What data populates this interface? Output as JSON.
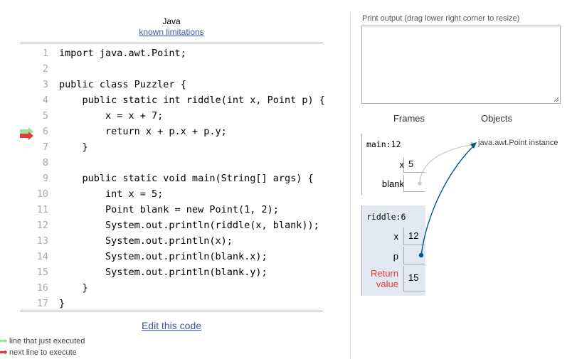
{
  "header": {
    "language": "Java",
    "limitations_link": "known limitations"
  },
  "code": [
    {
      "num": "1",
      "text": "import java.awt.Point;"
    },
    {
      "num": "2",
      "text": ""
    },
    {
      "num": "3",
      "text": "public class Puzzler {"
    },
    {
      "num": "4",
      "text": "    public static int riddle(int x, Point p) {"
    },
    {
      "num": "5",
      "text": "        x = x + 7;"
    },
    {
      "num": "6",
      "text": "        return x + p.x + p.y;"
    },
    {
      "num": "7",
      "text": "    }"
    },
    {
      "num": "8",
      "text": ""
    },
    {
      "num": "9",
      "text": "    public static void main(String[] args) {"
    },
    {
      "num": "10",
      "text": "        int x = 5;"
    },
    {
      "num": "11",
      "text": "        Point blank = new Point(1, 2);"
    },
    {
      "num": "12",
      "text": "        System.out.println(riddle(x, blank));"
    },
    {
      "num": "13",
      "text": "        System.out.println(x);"
    },
    {
      "num": "14",
      "text": "        System.out.println(blank.x);"
    },
    {
      "num": "15",
      "text": "        System.out.println(blank.y);"
    },
    {
      "num": "16",
      "text": "    }"
    },
    {
      "num": "17",
      "text": "}"
    }
  ],
  "execution": {
    "just_executed_line": "6",
    "next_line": "6",
    "just_executed_color": "#a0e0a0",
    "next_color": "#e33c3c"
  },
  "footer": {
    "edit_link": "Edit this code",
    "legend_just_executed": "line that just executed",
    "legend_next": "next line to execute"
  },
  "output": {
    "label": "Print output (drag lower right corner to resize)",
    "content": ""
  },
  "viz": {
    "frames_header": "Frames",
    "objects_header": "Objects",
    "frames": [
      {
        "name": "main:12",
        "vars": [
          {
            "name": "x",
            "value": "5"
          },
          {
            "name": "blank",
            "value": ""
          }
        ]
      },
      {
        "name": "riddle:6",
        "vars": [
          {
            "name": "x",
            "value": "12"
          },
          {
            "name": "p",
            "value": ""
          }
        ],
        "return_label": "Return value",
        "return_line1": "Return",
        "return_line2": "value",
        "return_value": "15"
      }
    ],
    "heap_object": "java.awt.Point instance",
    "active_arrow_color": "#005583",
    "inactive_arrow_color": "#cccccc"
  }
}
